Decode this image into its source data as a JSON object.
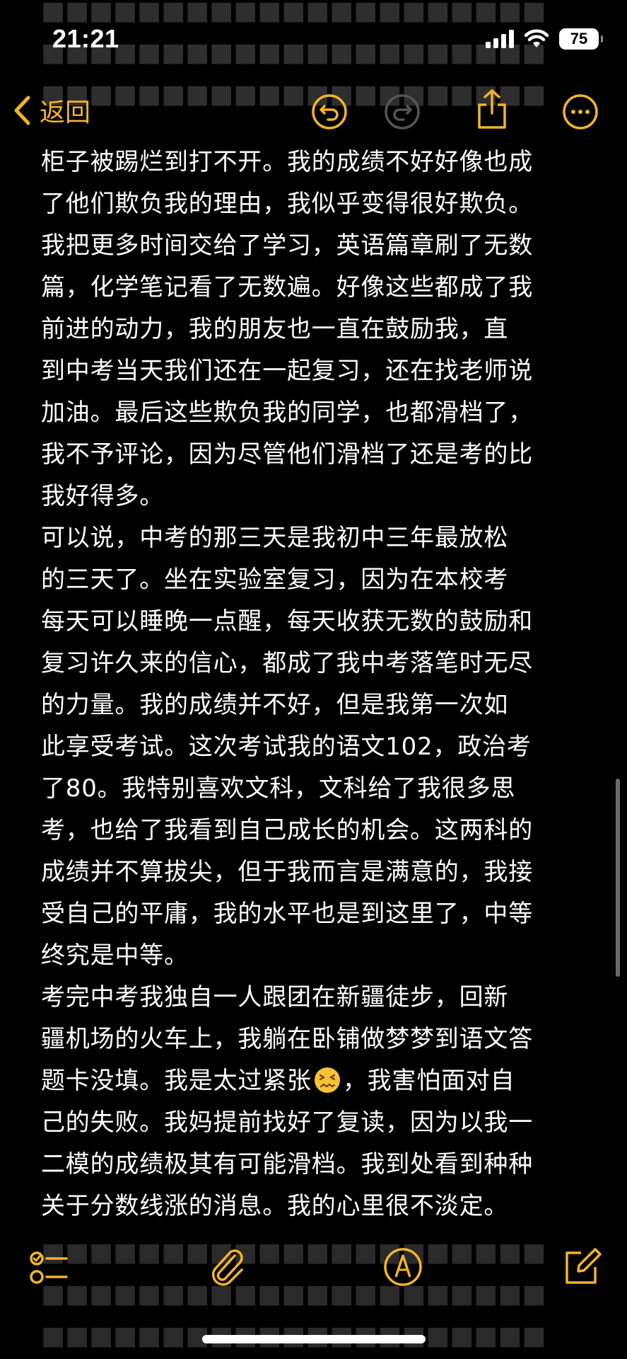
{
  "status_bar": {
    "time": "21:21",
    "battery": "75"
  },
  "nav": {
    "back_label": "返回"
  },
  "note": {
    "lines": [
      "柜子被踢烂到打不开。我的成绩不好好像也成",
      "了他们欺负我的理由，我似乎变得很好欺负。",
      "我把更多时间交给了学习，英语篇章刷了无数",
      "篇，化学笔记看了无数遍。好像这些都成了我",
      "前进的动力，我的朋友也一直在鼓励我，直",
      "到中考当天我们还在一起复习，还在找老师说",
      "加油。最后这些欺负我的同学，也都滑档了，",
      "我不予评论，因为尽管他们滑档了还是考的比",
      "我好得多。",
      "  可以说，中考的那三天是我初中三年最放松",
      "的三天了。坐在实验室复习，因为在本校考",
      "每天可以睡晚一点醒，每天收获无数的鼓励和",
      "复习许久来的信心，都成了我中考落笔时无尽",
      "的力量。我的成绩并不好，但是我第一次如",
      "此享受考试。这次考试我的语文102，政治考",
      "了80。我特别喜欢文科，文科给了我很多思",
      "考，也给了我看到自己成长的机会。这两科的",
      "成绩并不算拔尖，但于我而言是满意的，我接",
      "受自己的平庸，我的水平也是到这里了，中等",
      "终究是中等。",
      "  考完中考我独自一人跟团在新疆徒步，回新",
      "疆机场的火车上，我躺在卧铺做梦梦到语文答"
    ],
    "emoji_line_before": "题卡没填。我是太过紧张",
    "emoji_line_after": "，我害怕面对自",
    "lines_after": [
      "己的失败。我妈提前找好了复读，因为以我一",
      "二模的成绩极其有可能滑档。我到处看到种种",
      "关于分数线涨的消息。我的心里很不淡定。"
    ]
  },
  "icons": {
    "accent_color": "#f2b429",
    "nav": [
      "undo-icon",
      "redo-icon",
      "share-icon",
      "more-icon"
    ],
    "toolbar": [
      "checklist-icon",
      "attachment-icon",
      "markup-icon",
      "compose-icon"
    ],
    "inline_emoji": "confounded-face-emoji"
  }
}
